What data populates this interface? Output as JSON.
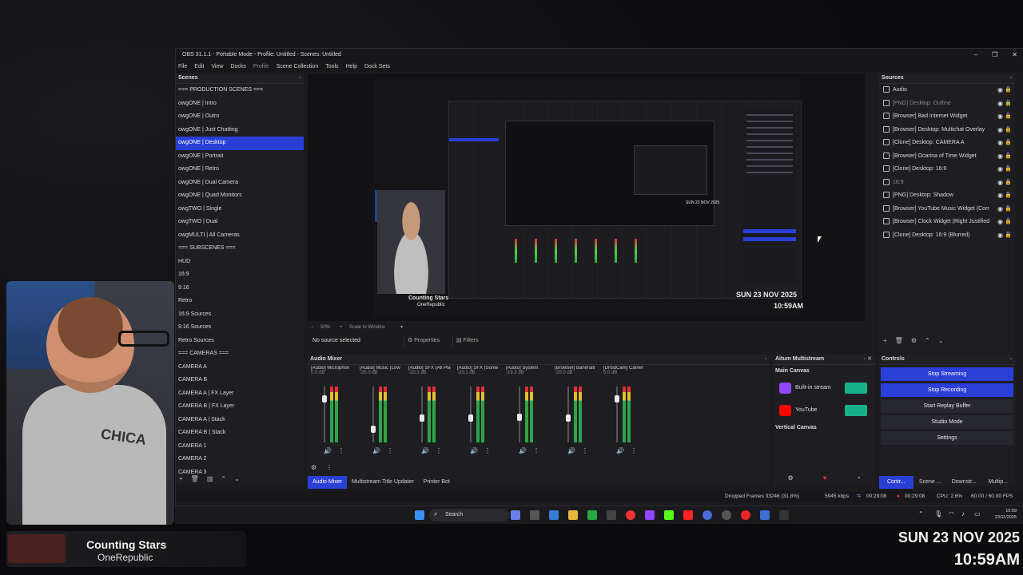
{
  "window": {
    "title": "OBS 31.1.1 - Portable Mode - Profile: Untitled - Scenes: Untitled",
    "controls": [
      "–",
      "❐",
      "✕"
    ]
  },
  "menu": [
    "File",
    "Edit",
    "View",
    "Docks",
    "Profile",
    "Scene Collection",
    "Tools",
    "Help",
    "Dock Sets"
  ],
  "scenes": {
    "header": "Scenes",
    "items": [
      "=== PRODUCTION SCENES ===",
      "owgONE | Intro",
      "owgONE | Outro",
      "owgONE | Just Chatting",
      "owgONE | Desktop",
      "owgONE | Portrait",
      "owgONE | Retro",
      "owgONE | Dual Camera",
      "owgONE | Quad Monitors",
      "owgTWO | Single",
      "owgTWO | Dual",
      "owgMULTI | All Cameras",
      "=== SUBSCENES ===",
      "HUD",
      "16:9",
      "9:16",
      "Retro",
      "16:9 Sources",
      "9:16 Sources",
      "Retro Sources",
      "=== CAMERAS ===",
      "CAMERA A",
      "CAMERA B",
      "CAMERA A | FX Layer",
      "CAMERA B | FX Layer",
      "CAMERA A | Stack",
      "CAMERA B | Stack",
      "CAMERA 1",
      "CAMERA 2",
      "CAMERA 3"
    ],
    "selected_index": 4
  },
  "preview": {
    "inner_song": "Counting Stars",
    "inner_artist": "OneRepublic",
    "inner_date": "SUN 23 NOV 2025",
    "inner_time": "10:59AM",
    "inner_small_date": "SUN 23 NOV 2025",
    "zoom": "50%",
    "scale_mode": "Scale to Window"
  },
  "source_bar": {
    "status": "No source selected",
    "properties": "Properties",
    "filters": "Filters"
  },
  "sources": {
    "header": "Sources",
    "items": [
      {
        "label": "Audio",
        "dim": false
      },
      {
        "label": "[PNG] Desktop: Outline",
        "dim": true
      },
      {
        "label": "[Browser] Bad Internet Widget",
        "dim": false
      },
      {
        "label": "[Browser] Desktop: Multichat Overlay",
        "dim": false
      },
      {
        "label": "[Clone] Desktop: CAMERA A",
        "dim": false
      },
      {
        "label": "[Browser] Ocarina of Time Widget",
        "dim": false
      },
      {
        "label": "[Clone] Desktop: 16:9",
        "dim": false
      },
      {
        "label": "16:9",
        "dim": true
      },
      {
        "label": "[PNG] Desktop: Shadow",
        "dim": false
      },
      {
        "label": "[Browser] YouTube Music Widget (Corr",
        "dim": false
      },
      {
        "label": "[Browser] Clock Widget (Right Justified",
        "dim": false
      },
      {
        "label": "[Clone] Desktop: 16:9 (Blurred)",
        "dim": false
      }
    ]
  },
  "mixer": {
    "header": "Audio Mixer",
    "channels": [
      {
        "name": "[Audio] Microphon",
        "db": "0.0 dB",
        "level": 0.85
      },
      {
        "name": "[Audio] Music (Low",
        "db": "-35.0 dB",
        "level": 0.3
      },
      {
        "name": "[Audio] SFX (All Pla",
        "db": "-20.1 dB",
        "level": 0.5
      },
      {
        "name": "[Audio] SFX (Some",
        "db": "-20.1 dB",
        "level": 0.5
      },
      {
        "name": "[Audio] System",
        "db": "-19.3 dB",
        "level": 0.52
      },
      {
        "name": "[Browser] Banimati",
        "db": "-20.0 dB",
        "level": 0.5
      },
      {
        "name": "[DroidCam] Camer",
        "db": "0.0 dB",
        "level": 0.85
      }
    ]
  },
  "bottom_tabs": [
    "Audio Mixer",
    "Multistream Title Updater",
    "Printer Bot"
  ],
  "multistream": {
    "header": "Aitum Multistream",
    "main_canvas": "Main Canvas",
    "outputs": [
      {
        "name": "Built-in stream",
        "color": "#9146ff"
      },
      {
        "name": "YouTube",
        "color": "#ff0000"
      }
    ],
    "vertical_canvas": "Vertical Canvas"
  },
  "controls": {
    "header": "Controls",
    "buttons": [
      {
        "label": "Stop Streaming",
        "active": true
      },
      {
        "label": "Stop Recording",
        "active": true
      },
      {
        "label": "Start Replay Buffer",
        "active": false
      },
      {
        "label": "Studio Mode",
        "active": false
      },
      {
        "label": "Settings",
        "active": false
      }
    ],
    "tabs": [
      "Contr...",
      "Scene ...",
      "Downstr...",
      "Multip..."
    ]
  },
  "status": {
    "dropped": "Dropped Frames 33246 (31.8%)",
    "kbps": "5945 kbps",
    "stream_time": "00:29:08",
    "rec_time": "00:29:08",
    "cpu": "CPU: 2.6%",
    "fps": "60.00 / 60.00 FPS"
  },
  "taskbar": {
    "search": "Search",
    "time": "10:59",
    "date": "23/11/2025"
  },
  "now_playing": {
    "song": "Counting Stars",
    "artist": "OneRepublic"
  },
  "clock": {
    "date": "SUN 23 NOV 2025",
    "time": "10:59AM"
  },
  "colors": {
    "accent": "#2a3fd6",
    "toggle": "#18b08a",
    "twitch": "#9146ff",
    "youtube": "#ff0000"
  }
}
